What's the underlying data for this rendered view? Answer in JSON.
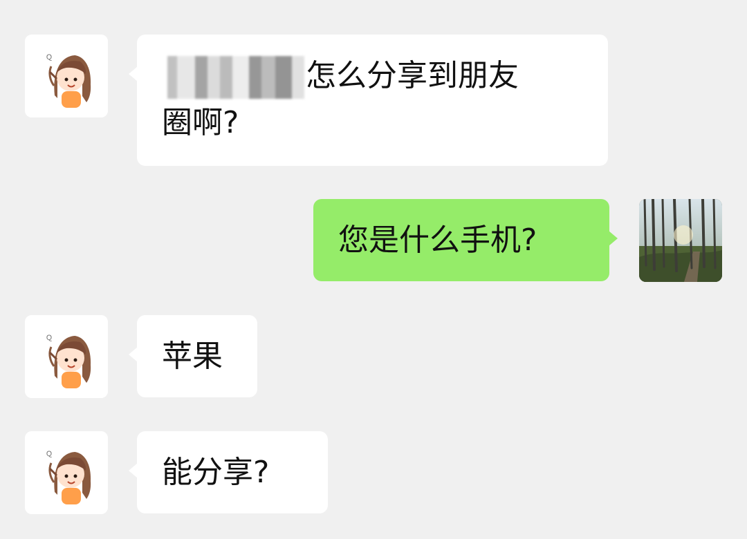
{
  "messages": [
    {
      "id": "m1",
      "side": "incoming",
      "text_visible": "怎么分享到朋友",
      "text_line2": "圈啊?"
    },
    {
      "id": "m2",
      "side": "outgoing",
      "text": "您是什么手机?"
    },
    {
      "id": "m3",
      "side": "incoming",
      "text": "苹果"
    },
    {
      "id": "m4",
      "side": "incoming",
      "text": "能分享?"
    }
  ],
  "colors": {
    "background": "#f0f0f0",
    "incoming_bubble": "#ffffff",
    "outgoing_bubble": "#95ec69",
    "text": "#111111"
  },
  "icons": {
    "contact_avatar": "girl-avatar-icon",
    "self_avatar": "forest-photo-avatar"
  }
}
